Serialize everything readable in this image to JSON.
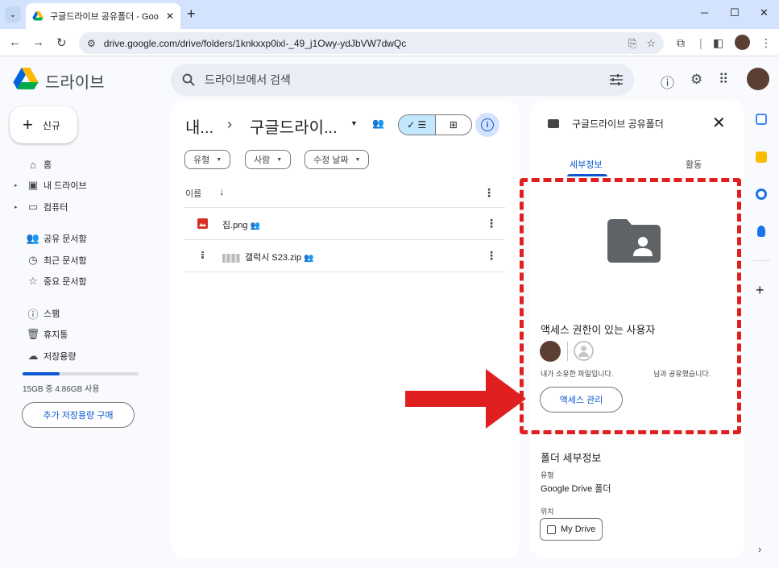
{
  "browser": {
    "tab_title": "구글드라이브 공유폴더 - Goo",
    "tab_close": "✕",
    "new_tab": "+",
    "minimize": "─",
    "maximize": "☐",
    "close": "✕",
    "url": "drive.google.com/drive/folders/1knkxxp0ixl-_49_j1Owy-ydJbVW7dwQc"
  },
  "header": {
    "logo_text": "드라이브",
    "search_placeholder": "드라이브에서 검색"
  },
  "sidebar": {
    "new_label": "신규",
    "items": [
      {
        "label": "홈"
      },
      {
        "label": "내 드라이브"
      },
      {
        "label": "컴퓨터"
      },
      {
        "label": "공유 문서함"
      },
      {
        "label": "최근 문서함"
      },
      {
        "label": "중요 문서함"
      },
      {
        "label": "스팸"
      },
      {
        "label": "휴지통"
      },
      {
        "label": "저장용량"
      }
    ],
    "storage_used_fraction": 0.32,
    "storage_text": "15GB 중 4.86GB 사용",
    "buy_storage_label": "추가 저장용량 구매"
  },
  "main": {
    "breadcrumb_root": "내...",
    "breadcrumb_sep": "›",
    "breadcrumb_current": "구글드라이...",
    "filters": [
      {
        "label": "유형"
      },
      {
        "label": "사람"
      },
      {
        "label": "수정 날짜"
      }
    ],
    "column_name": "이름",
    "files": [
      {
        "name": "집.png",
        "icon": "image-icon"
      },
      {
        "name": "갤럭시 S23.zip",
        "icon": "zip-icon"
      }
    ]
  },
  "details": {
    "title": "구글드라이브 공유폴더",
    "tab_details": "세부정보",
    "tab_activity": "활동",
    "access_title": "액세스 권한이 있는 사용자",
    "owned_text": "내가 소유한 파일입니다.",
    "shared_text": "님과 공유했습니다.",
    "manage_access_label": "액세스 관리",
    "folder_details_title": "폴더 세부정보",
    "type_label": "유형",
    "type_value": "Google Drive 폴더",
    "location_label": "위치",
    "location_value": "My Drive"
  },
  "colors": {
    "accent": "#0b57d0",
    "highlight": "#e02020",
    "avatar": "#5b3f32"
  }
}
